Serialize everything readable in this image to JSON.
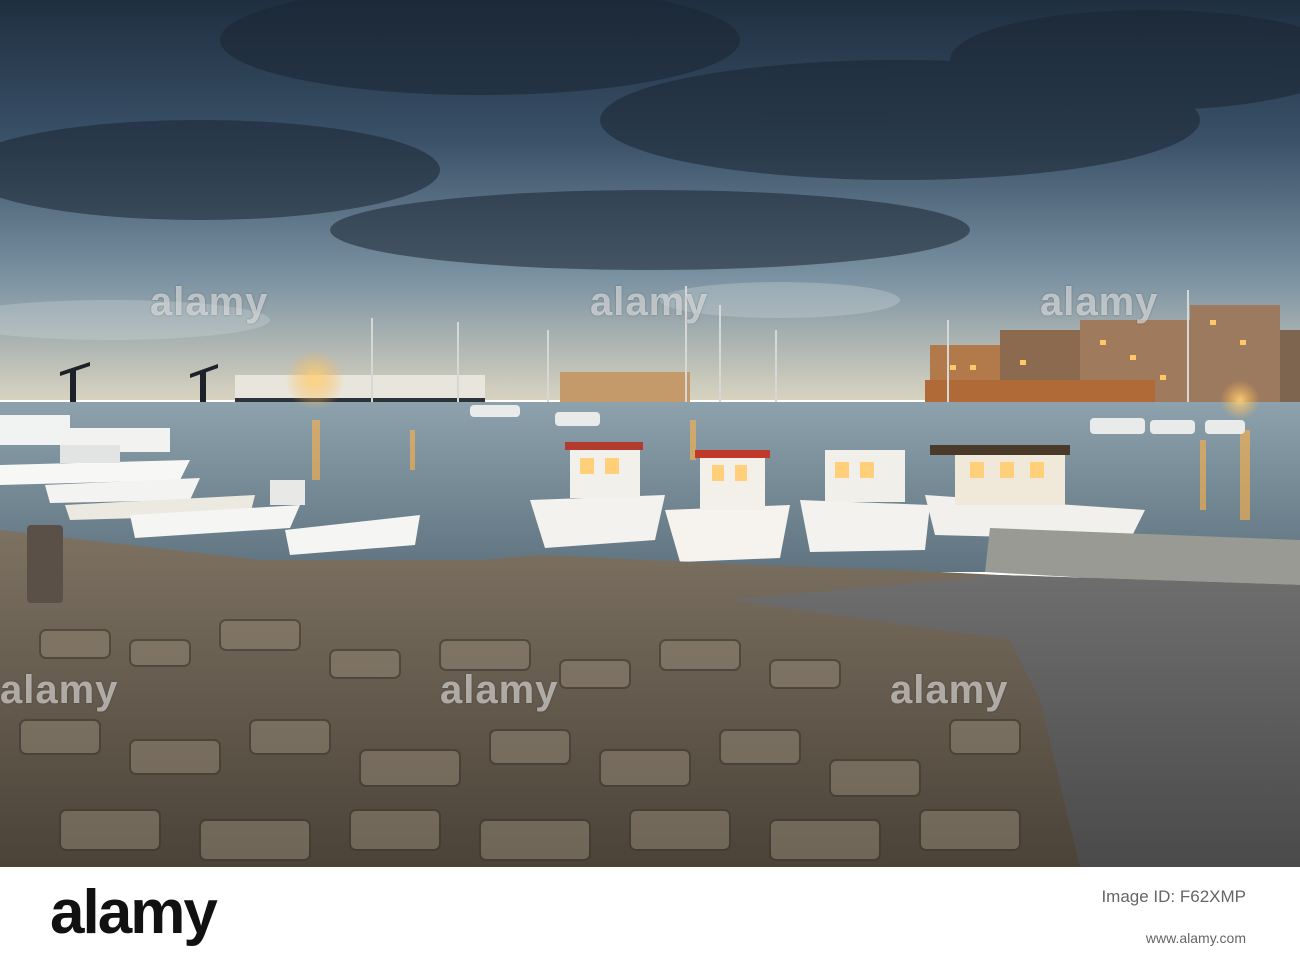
{
  "watermark": {
    "text": "alamy"
  },
  "footer": {
    "logo_text": "alamy",
    "stock_id_label": "Image ID: F62XMP",
    "stock_id": "F62XMP",
    "url": "www.alamy.com"
  },
  "scene": {
    "sky_colors": [
      "#2b3e52",
      "#5c7488",
      "#a7b7bd",
      "#d9d6c5"
    ],
    "water_colors": [
      "#6a7d8a",
      "#9fb0b8"
    ],
    "light_color": "#ffb347"
  }
}
